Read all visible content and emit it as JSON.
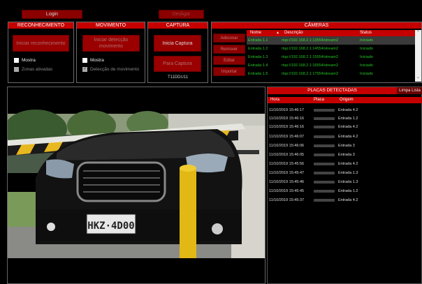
{
  "top": {
    "login": "Login",
    "sair": "Desligar"
  },
  "reconhecimento": {
    "title": "RECONHECIMENTO",
    "button": "Iniciar reconhecimento",
    "mostra": "Mostra",
    "zonas": "Zonas ativadas"
  },
  "movimento": {
    "title": "MOVIMENTO",
    "button": "Iniciar detecção movimento",
    "mostra": "Mostra",
    "deteccao": "Detecção de movimento"
  },
  "captura": {
    "title": "CAPTURA",
    "inicia": "Inicia Captura",
    "para": "Para Captura",
    "id": "T11DDU11"
  },
  "cameras": {
    "title": "CÂMERAS",
    "side_buttons": [
      "Adicionar",
      "Remover",
      "Editar",
      "Importar"
    ],
    "columns": [
      "Nome",
      "Descrição",
      "Status"
    ],
    "rows": [
      {
        "nome": "Entrada 1.1",
        "descricao": "rtsp://192.168.2.1:13554/stream2",
        "status": "Iniciado"
      },
      {
        "nome": "Entrada 1.2",
        "descricao": "rtsp://192.168.2.1:14554/stream2",
        "status": "Iniciado"
      },
      {
        "nome": "Entrada 1.3",
        "descricao": "rtsp://192.168.2.1:15554/stream2",
        "status": "Iniciado"
      },
      {
        "nome": "Entrada 1.4",
        "descricao": "rtsp://192.168.2.1:16554/stream2",
        "status": "Iniciado"
      },
      {
        "nome": "Entrada 1.5",
        "descricao": "rtsp://192.168.2.1:17554/stream2",
        "status": "Iniciado"
      }
    ]
  },
  "placas": {
    "title": "PLACAS DETECTADAS",
    "limpa": "Limpa Lista",
    "columns": [
      "Hora",
      "Placa",
      "Origem"
    ],
    "rows": [
      {
        "hora": "11/10/2019 15:46:17",
        "origem": "Entrada 4.2"
      },
      {
        "hora": "11/10/2019 15:46:16",
        "origem": "Entrada 1.2"
      },
      {
        "hora": "11/10/2019 15:46:16",
        "origem": "Entrada 4.2"
      },
      {
        "hora": "11/10/2019 15:46:07",
        "origem": "Entrada 4.2"
      },
      {
        "hora": "11/10/2019 15:46:06",
        "origem": "Entrada 3"
      },
      {
        "hora": "11/10/2019 15:46:05",
        "origem": "Entrada 3"
      },
      {
        "hora": "11/10/2019 15:45:56",
        "origem": "Entrada 4.2"
      },
      {
        "hora": "11/10/2019 15:45:47",
        "origem": "Entrada 1.3"
      },
      {
        "hora": "11/10/2019 15:45:46",
        "origem": "Entrada 1.3"
      },
      {
        "hora": "11/10/2019 15:45:45",
        "origem": "Entrada 1.2"
      },
      {
        "hora": "11/10/2019 15:45:37",
        "origem": "Entrada 4.2"
      }
    ]
  },
  "video": {
    "plate": "HKZ·4D00"
  }
}
